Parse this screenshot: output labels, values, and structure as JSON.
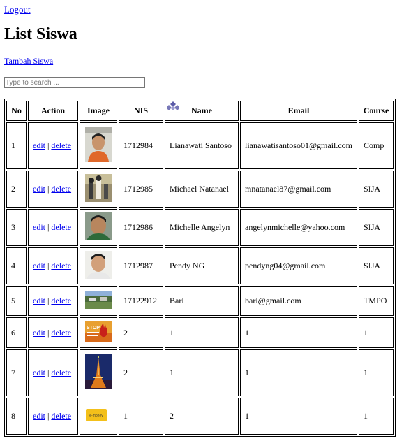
{
  "nav": {
    "logout": "Logout",
    "add": "Tambah Siswa"
  },
  "page_title": "List Siswa",
  "search": {
    "placeholder": "Type to search ...",
    "value": ""
  },
  "table": {
    "columns": [
      "No",
      "Action",
      "Image",
      "NIS",
      "Name",
      "Email",
      "Course"
    ],
    "action_labels": {
      "edit": "edit",
      "delete": "delete",
      "separator": "|"
    },
    "rows": [
      {
        "no": "1",
        "nis": "1712984",
        "name": "Lianawati Santoso",
        "email": "lianawatisantoso01@gmail.com",
        "course": "Comp",
        "image": "portrait-boy-orange-shirt"
      },
      {
        "no": "2",
        "nis": "1712985",
        "name": "Michael Natanael",
        "email": "mnatanael87@gmail.com",
        "course": "SIJA",
        "image": "photo-figures"
      },
      {
        "no": "3",
        "nis": "1712986",
        "name": "Michelle Angelyn",
        "email": "angelynmichelle@yahoo.com",
        "course": "SIJA",
        "image": "portrait-boy-green"
      },
      {
        "no": "4",
        "nis": "1712987",
        "name": "Pendy NG",
        "email": "pendyng04@gmail.com",
        "course": "SIJA",
        "image": "portrait-boy-white"
      },
      {
        "no": "5",
        "nis": "17122912",
        "name": "Bari",
        "email": "bari@gmail.com",
        "course": "TMPO",
        "image": "landscape-field"
      },
      {
        "no": "6",
        "nis": "2",
        "name": "1",
        "email": "1",
        "course": "1",
        "image": "stop-hand-sign"
      },
      {
        "no": "7",
        "nis": "2",
        "name": "1",
        "email": "1",
        "course": "1",
        "image": "tower-night"
      },
      {
        "no": "8",
        "nis": "1",
        "name": "2",
        "email": "1",
        "course": "1",
        "image": "emoney-card"
      }
    ]
  },
  "thumb_text": {
    "stop": "STOP",
    "emoney": "e-money"
  }
}
